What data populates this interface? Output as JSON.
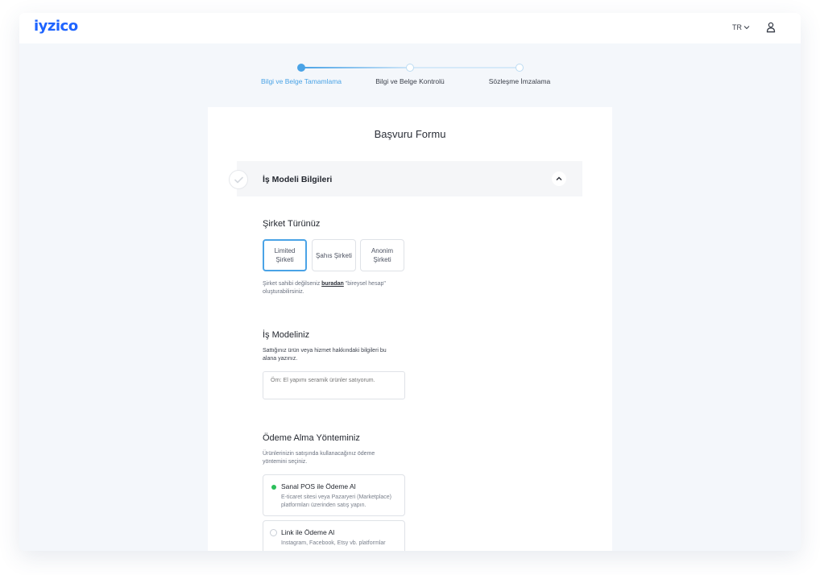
{
  "header": {
    "logo": "iyzico",
    "language": "TR"
  },
  "stepper": {
    "steps": [
      {
        "label": "Bilgi ve Belge Tamamlama",
        "state": "active"
      },
      {
        "label": "Bilgi ve Belge Kontrolü",
        "state": "pending"
      },
      {
        "label": "Sözleşme İmzalama",
        "state": "pending"
      }
    ]
  },
  "form": {
    "title": "Başvuru Formu",
    "section": {
      "title": "İş Modeli Bilgileri"
    },
    "company_type": {
      "heading": "Şirket Türünüz",
      "options": [
        {
          "label": "Limited Şirketi",
          "selected": true
        },
        {
          "label": "Şahıs Şirketi",
          "selected": false
        },
        {
          "label": "Anonim Şirketi",
          "selected": false
        }
      ],
      "hint_before": "Şirket sahibi değilseniz ",
      "hint_link": "buradan",
      "hint_after": " \"bireysel hesap\" oluşturabilirsiniz."
    },
    "business_model": {
      "heading": "İş Modeliniz",
      "description": "Sattığınız ürün veya hizmet hakkındaki bilgileri bu alana yazınız.",
      "placeholder": "Örn: El yapımı seramik ürünler satıyorum."
    },
    "payment_method": {
      "heading": "Ödeme Alma Yönteminiz",
      "description": "Ürünlerinizin satışında kullanacağınız ödeme yöntemini seçiniz.",
      "options": [
        {
          "title": "Sanal POS ile Ödeme Al",
          "description": "E-ticaret sitesi veya Pazaryeri (Marketplace) platformları üzerinden satış yapın.",
          "selected": true
        },
        {
          "title": "Link ile Ödeme Al",
          "description": "Instagram, Facebook, Etsy vb. platformlar",
          "selected": false
        }
      ]
    }
  },
  "colors": {
    "brand": "#1e64ff",
    "active_step": "#4aa3e6",
    "selected_radio": "#2bbf5a",
    "background": "#f4f7fb"
  }
}
